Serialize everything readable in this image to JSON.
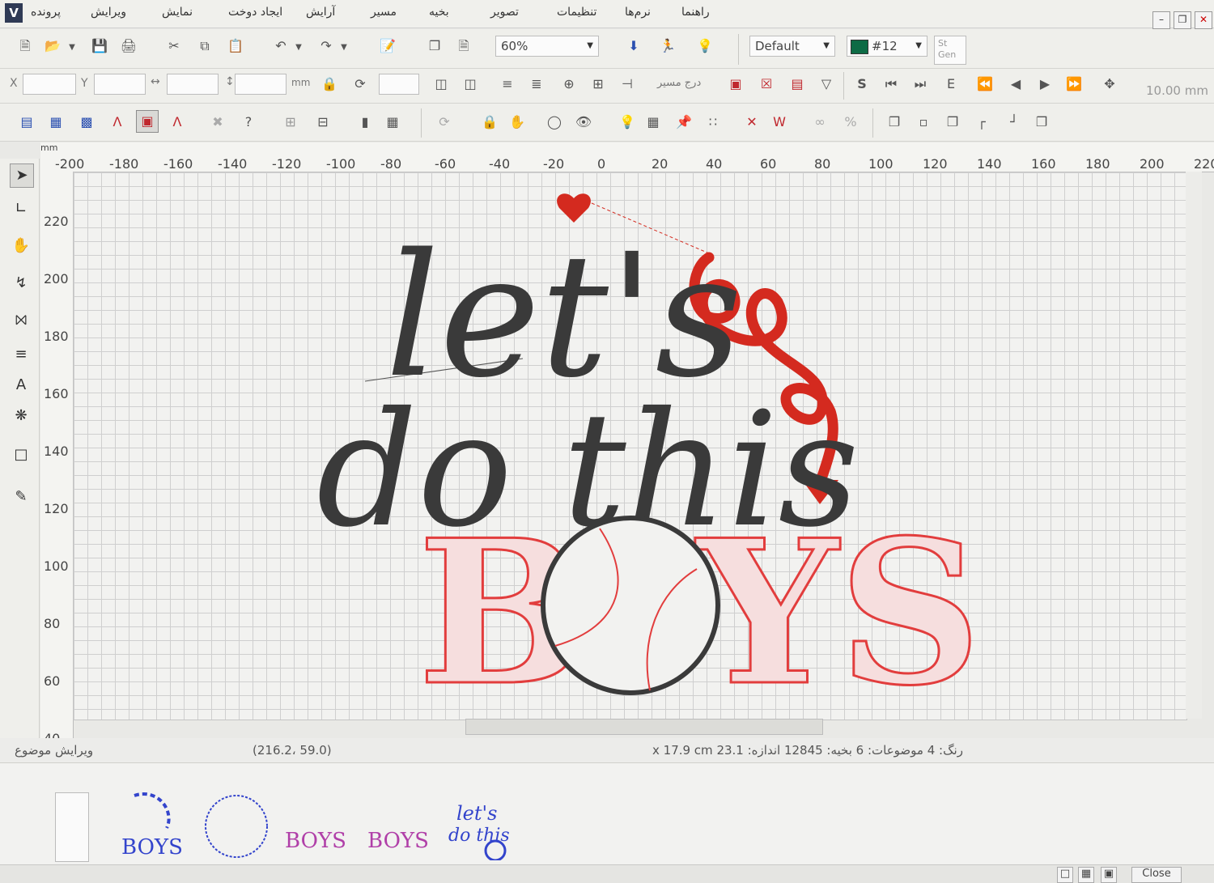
{
  "menu": {
    "items": [
      "پرونده",
      "ویرایش",
      "نمایش",
      "ایجاد دوخت",
      "آرایش",
      "مسیر",
      "بخیه",
      "تصویر",
      "تنظیمات",
      "نرم‌ها",
      "راهنما"
    ]
  },
  "toolbar": {
    "zoom_value": "60%",
    "style_value": "Default",
    "color_value": "#12",
    "color_swatch": "#0d6b45",
    "st_label": "St",
    "gen_label": "Gen",
    "x_label": "X",
    "y_label": "Y",
    "units_label": "mm",
    "insert_path_label": "درج مسیر",
    "s_label": "S",
    "e_label": "E",
    "spacing_value": "10.00 mm"
  },
  "ruler": {
    "unit": "mm",
    "h_ticks": [
      "-200",
      "-180",
      "-160",
      "-140",
      "-120",
      "-100",
      "-80",
      "-60",
      "-40",
      "-20",
      "0",
      "20",
      "40",
      "60",
      "80",
      "100",
      "120",
      "140",
      "160",
      "180",
      "200",
      "220"
    ],
    "v_ticks": [
      "220",
      "200",
      "180",
      "160",
      "140",
      "120",
      "100",
      "80",
      "60",
      "40"
    ]
  },
  "design": {
    "line1": "let's",
    "line2": "do this",
    "boys_b": "B",
    "boys_ys": "YS",
    "text_color": "#3a3a3a",
    "accent_color": "#d42a1f"
  },
  "status": {
    "edit_object": "ویرایش موضوع",
    "coords": "(216.2، 59.0)",
    "info": "رنگ: 4  موضوعات: 6  بخیه: 12845  اندازه: 23.1 x 17.9 cm"
  },
  "strip": {
    "thumb_boys": "BOYS",
    "thumb_lets": "let's",
    "thumb_do_this": "do this"
  },
  "footer": {
    "close_label": "Close"
  }
}
